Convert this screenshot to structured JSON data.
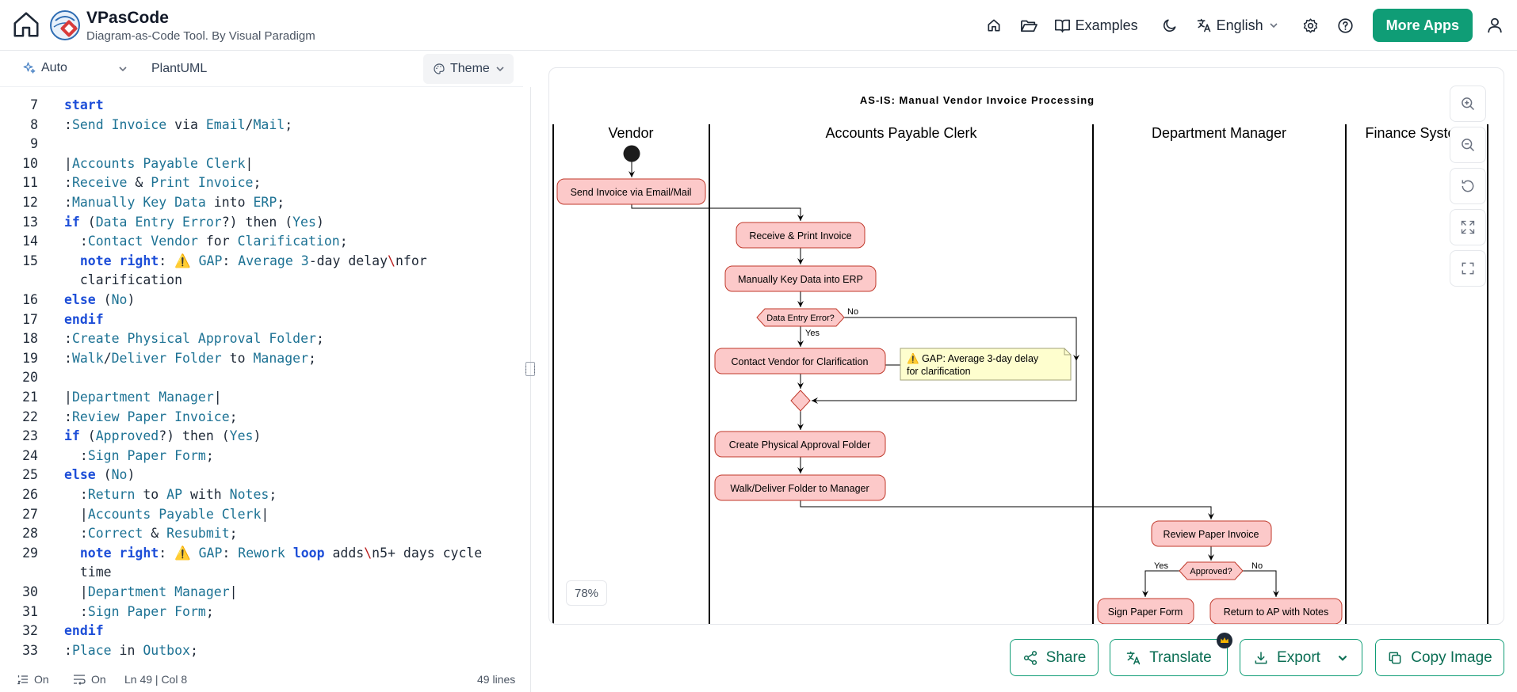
{
  "header": {
    "app_name": "VPasCode",
    "app_subtitle": "Diagram-as-Code Tool. By Visual Paradigm",
    "examples_label": "Examples",
    "language_label": "English",
    "more_apps_label": "More Apps",
    "icons": [
      "home-icon",
      "folder-open-icon",
      "book-icon",
      "moon-icon",
      "translate-icon",
      "gear-icon",
      "help-icon",
      "user-icon"
    ]
  },
  "editor": {
    "toolbar": {
      "mode_label": "Auto",
      "language_label": "PlantUML",
      "theme_label": "Theme"
    },
    "lines": [
      {
        "n": "7",
        "html": "<span class='kw'>start</span>"
      },
      {
        "n": "8",
        "html": ":<span class='id'>Send</span> <span class='id'>Invoice</span> via <span class='id'>Email</span>/<span class='id'>Mail</span>;"
      },
      {
        "n": "9",
        "html": ""
      },
      {
        "n": "10",
        "html": "|<span class='id'>Accounts</span> <span class='id'>Payable</span> <span class='id'>Clerk</span>|"
      },
      {
        "n": "11",
        "html": ":<span class='id'>Receive</span> &amp; <span class='id'>Print</span> <span class='id'>Invoice</span>;"
      },
      {
        "n": "12",
        "html": ":<span class='id'>Manually</span> <span class='id'>Key</span> <span class='id'>Data</span> into <span class='id'>ERP</span>;"
      },
      {
        "n": "13",
        "html": "<span class='kw'>if</span> (<span class='id'>Data</span> <span class='id'>Entry</span> <span class='id'>Error</span>?) then (<span class='id'>Yes</span>)"
      },
      {
        "n": "14",
        "html": "  :<span class='id'>Contact</span> <span class='id'>Vendor</span> for <span class='id'>Clarification</span>;"
      },
      {
        "n": "15",
        "html": "  <span class='kw'>note right</span>: ⚠️ <span class='id'>GAP</span>: <span class='id'>Average</span> <span class='id'>3</span>-day delay<span class='bs'>\\</span>nfor"
      },
      {
        "n": "",
        "html": "  clarification"
      },
      {
        "n": "16",
        "html": "<span class='kw'>else</span> (<span class='id'>No</span>)"
      },
      {
        "n": "17",
        "html": "<span class='kw'>endif</span>"
      },
      {
        "n": "18",
        "html": ":<span class='id'>Create</span> <span class='id'>Physical</span> <span class='id'>Approval</span> <span class='id'>Folder</span>;"
      },
      {
        "n": "19",
        "html": ":<span class='id'>Walk</span>/<span class='id'>Deliver</span> <span class='id'>Folder</span> to <span class='id'>Manager</span>;"
      },
      {
        "n": "20",
        "html": ""
      },
      {
        "n": "21",
        "html": "|<span class='id'>Department</span> <span class='id'>Manager</span>|"
      },
      {
        "n": "22",
        "html": ":<span class='id'>Review</span> <span class='id'>Paper</span> <span class='id'>Invoice</span>;"
      },
      {
        "n": "23",
        "html": "<span class='kw'>if</span> (<span class='id'>Approved</span>?) then (<span class='id'>Yes</span>)"
      },
      {
        "n": "24",
        "html": "  :<span class='id'>Sign</span> <span class='id'>Paper</span> <span class='id'>Form</span>;"
      },
      {
        "n": "25",
        "html": "<span class='kw'>else</span> (<span class='id'>No</span>)"
      },
      {
        "n": "26",
        "html": "  :<span class='id'>Return</span> to <span class='id'>AP</span> with <span class='id'>Notes</span>;"
      },
      {
        "n": "27",
        "html": "  |<span class='id'>Accounts</span> <span class='id'>Payable</span> <span class='id'>Clerk</span>|"
      },
      {
        "n": "28",
        "html": "  :<span class='id'>Correct</span> &amp; <span class='id'>Resubmit</span>;"
      },
      {
        "n": "29",
        "html": "  <span class='kw'>note right</span>: ⚠️ <span class='id'>GAP</span>: <span class='id'>Rework</span> <span class='kw'>loop</span> adds<span class='bs'>\\</span>n5+ days cycle"
      },
      {
        "n": "",
        "html": "  time"
      },
      {
        "n": "30",
        "html": "  |<span class='id'>Department</span> <span class='id'>Manager</span>|"
      },
      {
        "n": "31",
        "html": "  :<span class='id'>Sign</span> <span class='id'>Paper</span> <span class='id'>Form</span>;"
      },
      {
        "n": "32",
        "html": "<span class='kw'>endif</span>"
      },
      {
        "n": "33",
        "html": ":<span class='id'>Place</span> in <span class='id'>Outbox</span>;"
      }
    ],
    "status": {
      "line_numbers": "On",
      "wrap": "On",
      "cursor": "Ln 49 | Col 8",
      "line_count": "49 lines"
    }
  },
  "diagram": {
    "title": "AS-IS: Manual Vendor Invoice Processing",
    "lanes": [
      "Vendor",
      "Accounts Payable Clerk",
      "Department Manager",
      "Finance System"
    ],
    "activities": {
      "send_invoice": "Send Invoice via Email/Mail",
      "receive_print": "Receive & Print Invoice",
      "manual_key": "Manually Key Data into ERP",
      "contact_vendor": "Contact Vendor for Clarification",
      "create_folder": "Create Physical Approval Folder",
      "walk_deliver": "Walk/Deliver Folder to Manager",
      "review_invoice": "Review Paper Invoice",
      "sign_form": "Sign Paper Form",
      "return_ap": "Return to AP with Notes"
    },
    "decisions": {
      "data_entry_error": "Data Entry Error?",
      "approved": "Approved?"
    },
    "branch_labels": {
      "yes": "Yes",
      "no": "No"
    },
    "note": {
      "icon": "⚠️",
      "line1": "GAP: Average 3-day delay",
      "line2": "for clarification"
    },
    "zoom_level": "78%",
    "colors": {
      "activity_fill": "#fcc9c9",
      "activity_stroke": "#c0392b",
      "note_fill": "#fefece"
    }
  },
  "actions": {
    "share": "Share",
    "translate": "Translate",
    "export": "Export",
    "copy_image": "Copy Image"
  }
}
